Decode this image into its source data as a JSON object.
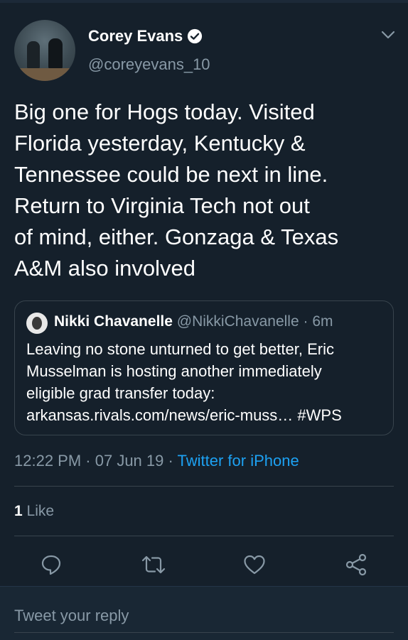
{
  "tweet": {
    "author": {
      "name": "Corey Evans",
      "handle": "@coreyevans_10"
    },
    "lines": [
      "Big one for Hogs today. Visited",
      "Florida yesterday, Kentucky &",
      "Tennessee could be next in line.",
      "Return to Virginia Tech not out",
      "of mind, either. Gonzaga & Texas",
      "A&M also involved"
    ],
    "quote": {
      "name": "Nikki Chavanelle",
      "handle": "@NikkiChavanelle",
      "time": "· 6m",
      "lines": [
        "Leaving no stone unturned to get better, Eric",
        "Musselman is hosting another immediately",
        "eligible grad transfer today:",
        "arkansas.rivals.com/news/eric-muss… #WPS"
      ]
    },
    "time": "12:22 PM",
    "date": "· 07 Jun 19 ·",
    "source": "Twitter for iPhone",
    "likes_count": "1",
    "likes_label": "Like"
  },
  "reply": {
    "placeholder": "Tweet your reply"
  },
  "icons": {
    "verified": "verified-badge-icon",
    "menu": "chevron-down-icon",
    "reply": "reply-icon",
    "retweet": "retweet-icon",
    "like": "heart-icon",
    "share": "share-icon"
  },
  "colors": {
    "background": "#15202b",
    "accent": "#1da1f2",
    "muted": "#8899a6",
    "border": "#38444d"
  }
}
